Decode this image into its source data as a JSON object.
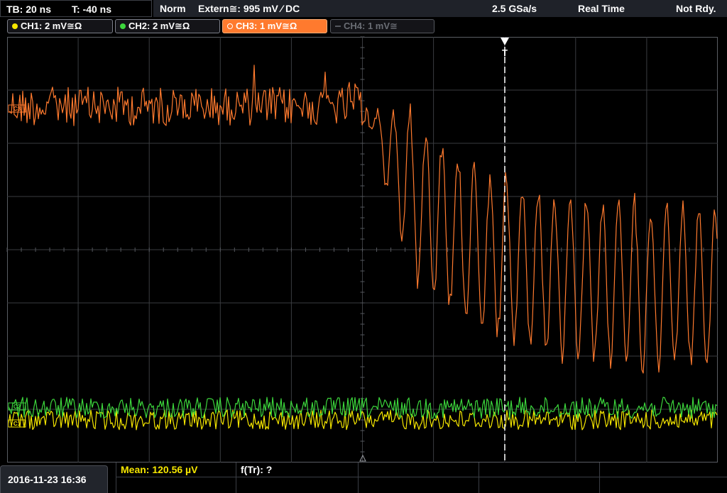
{
  "header": {
    "timebase": "TB: 20 ns",
    "trigger_time": "T: -40 ns",
    "mode": "Norm",
    "trigger_source": "Extern≅: 995 mV ⁄ DC",
    "sample_rate": "2.5 GSa/s",
    "acquisition": "Real Time",
    "state": "Not Rdy."
  },
  "channels": [
    {
      "label": "CH1: 2 mV≅Ω",
      "color": "#f5e600",
      "active": true
    },
    {
      "label": "CH2: 2 mV≅Ω",
      "color": "#3cd63c",
      "active": true
    },
    {
      "label": "CH3: 1 mV≅Ω",
      "color": "#ff7a2e",
      "active": true,
      "selected": true
    },
    {
      "label": "CH4: 1 mV≅",
      "color": "#6a6d74",
      "active": false
    }
  ],
  "markers": {
    "trigger_marker": "T",
    "ch3_marker": "C3",
    "ch2_marker": "C2",
    "ch1_marker": "C1"
  },
  "footer": {
    "datetime": "2016-11-23 16:36",
    "measurement_mean": "Mean: 120.56 µV",
    "measurement_ftr": "f(Tr): ?"
  },
  "colors": {
    "ch1": "#f5e600",
    "ch2": "#3cd63c",
    "ch3": "#ff7a2e",
    "grid": "#3a3c40",
    "trigger_line": "#ffffff"
  }
}
